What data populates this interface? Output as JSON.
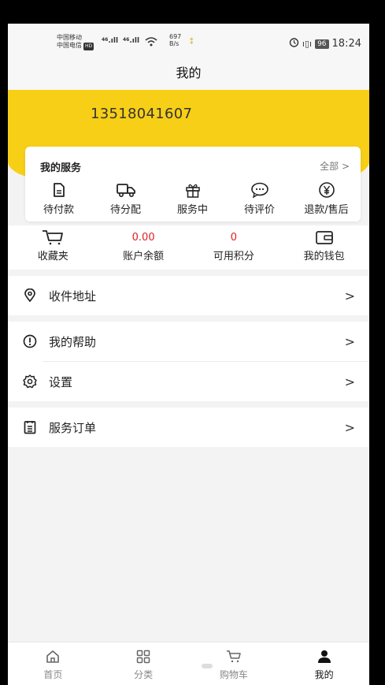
{
  "status_bar": {
    "carrier_1": "中国移动",
    "carrier_2": "中国电信",
    "hd": "HD",
    "net_1": "46",
    "net_2": "46",
    "speed_value": "697",
    "speed_unit": "B/s",
    "battery": "96",
    "time": "18:24"
  },
  "title": "我的",
  "user": {
    "phone": "13518041607"
  },
  "services": {
    "title": "我的服务",
    "all_label": "全部 >",
    "items": [
      {
        "label": "待付款",
        "icon": "payment-doc-icon"
      },
      {
        "label": "待分配",
        "icon": "truck-icon"
      },
      {
        "label": "服务中",
        "icon": "gift-icon"
      },
      {
        "label": "待评价",
        "icon": "comment-icon"
      },
      {
        "label": "退款/售后",
        "icon": "yen-icon"
      }
    ]
  },
  "stats": [
    {
      "label": "收藏夹",
      "value": "",
      "icon": "cart-icon"
    },
    {
      "label": "账户余额",
      "value": "0.00"
    },
    {
      "label": "可用积分",
      "value": "0"
    },
    {
      "label": "我的钱包",
      "value": "",
      "icon": "wallet-icon"
    }
  ],
  "menu": {
    "address": "收件地址",
    "help": "我的帮助",
    "settings": "设置",
    "orders": "服务订单",
    "chevron": ">"
  },
  "tabs": [
    {
      "label": "首页",
      "icon": "home-icon"
    },
    {
      "label": "分类",
      "icon": "grid-icon"
    },
    {
      "label": "购物车",
      "icon": "cart-icon"
    },
    {
      "label": "我的",
      "icon": "user-icon",
      "active": true
    }
  ],
  "colors": {
    "accent": "#f7cf17",
    "value_red": "#e02020"
  }
}
